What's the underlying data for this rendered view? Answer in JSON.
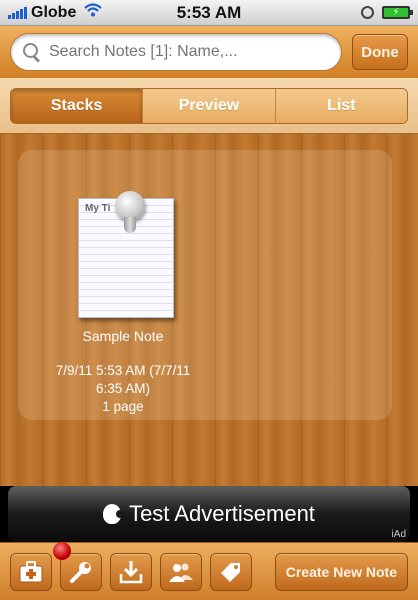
{
  "status_bar": {
    "carrier": "Globe",
    "time": "5:53 AM"
  },
  "search": {
    "placeholder": "Search Notes [1]: Name,...",
    "done_label": "Done"
  },
  "segments": [
    {
      "label": "Stacks",
      "active": true
    },
    {
      "label": "Preview",
      "active": false
    },
    {
      "label": "List",
      "active": false
    }
  ],
  "note": {
    "thumb_title": "My Ti",
    "name": "Sample Note",
    "date_line": "7/9/11 5:53 AM (7/7/11",
    "date_line2": "6:35 AM)",
    "pages": "1 page"
  },
  "ad": {
    "text": "Test Advertisement",
    "badge": "iAd"
  },
  "toolbar": {
    "icons": [
      "first-aid-icon",
      "wrench-icon",
      "inbox-download-icon",
      "contacts-share-icon",
      "price-tag-icon"
    ],
    "create_label": "Create New Note"
  },
  "colors": {
    "accent": "#d17f25",
    "wood": "#b36c26"
  }
}
